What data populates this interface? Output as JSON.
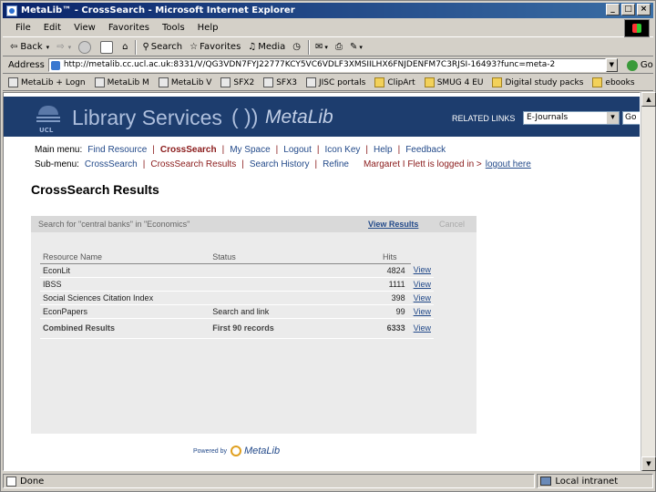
{
  "window": {
    "title": "MetaLib™ - CrossSearch - Microsoft Internet Explorer",
    "controls": [
      "_",
      "□",
      "×"
    ]
  },
  "menubar": [
    "File",
    "Edit",
    "View",
    "Favorites",
    "Tools",
    "Help"
  ],
  "toolbar": {
    "back": "Back",
    "search": "Search",
    "favorites": "Favorites",
    "media": "Media"
  },
  "address": {
    "label": "Address",
    "url": "http://metalib.cc.ucl.ac.uk:8331/V/QG3VDN7FYJ22777KCY5VC6VDLF3XMSIILHX6FNJDENFM7C3RJSI-16493?func=meta-2",
    "go": "Go"
  },
  "links": [
    {
      "label": "MetaLib + Logn",
      "type": "page"
    },
    {
      "label": "MetaLib M",
      "type": "page"
    },
    {
      "label": "MetaLib V",
      "type": "page"
    },
    {
      "label": "SFX2",
      "type": "page"
    },
    {
      "label": "SFX3",
      "type": "page"
    },
    {
      "label": "JISC portals",
      "type": "page"
    },
    {
      "label": "ClipArt",
      "type": "folder"
    },
    {
      "label": "SMUG 4 EU",
      "type": "folder"
    },
    {
      "label": "Digital study packs",
      "type": "folder"
    },
    {
      "label": "ebooks",
      "type": "folder"
    }
  ],
  "banner": {
    "ucl": "UCL",
    "library": "Library Services",
    "metalib": "MetaLib",
    "related_links_label": "RELATED LINKS",
    "related_links_value": "E-Journals",
    "go": "Go"
  },
  "nav": {
    "main_label": "Main menu:",
    "main_items": [
      "Find Resource",
      "CrossSearch",
      "My Space",
      "Logout",
      "Icon Key",
      "Help",
      "Feedback"
    ],
    "main_current": 1,
    "sub_label": "Sub-menu:",
    "sub_items": [
      "CrossSearch",
      "CrossSearch Results",
      "Search History",
      "Refine"
    ],
    "sub_current": 1,
    "user_text": "Margaret I Flett is logged in >",
    "logout_here": "logout here"
  },
  "page_title": "CrossSearch Results",
  "query": {
    "text": "Search for \"central banks\" in \"Economics\"",
    "view_results": "View Results",
    "cancel": "Cancel"
  },
  "table": {
    "headers": [
      "Resource Name",
      "Status",
      "Hits"
    ],
    "rows": [
      {
        "name": "EconLit",
        "status": "",
        "hits": "4824",
        "view": "View"
      },
      {
        "name": "IBSS",
        "status": "",
        "hits": "1111",
        "view": "View"
      },
      {
        "name": "Social Sciences Citation Index",
        "status": "",
        "hits": "398",
        "view": "View"
      },
      {
        "name": "EconPapers",
        "status": "Search and link",
        "hits": "99",
        "view": "View"
      }
    ],
    "combined": {
      "name": "Combined Results",
      "status": "First 90 records",
      "hits": "6333",
      "view": "View"
    }
  },
  "powered_by": {
    "label": "Powered by",
    "brand": "MetaLib"
  },
  "status": {
    "text": "Done",
    "zone": "Local intranet"
  }
}
